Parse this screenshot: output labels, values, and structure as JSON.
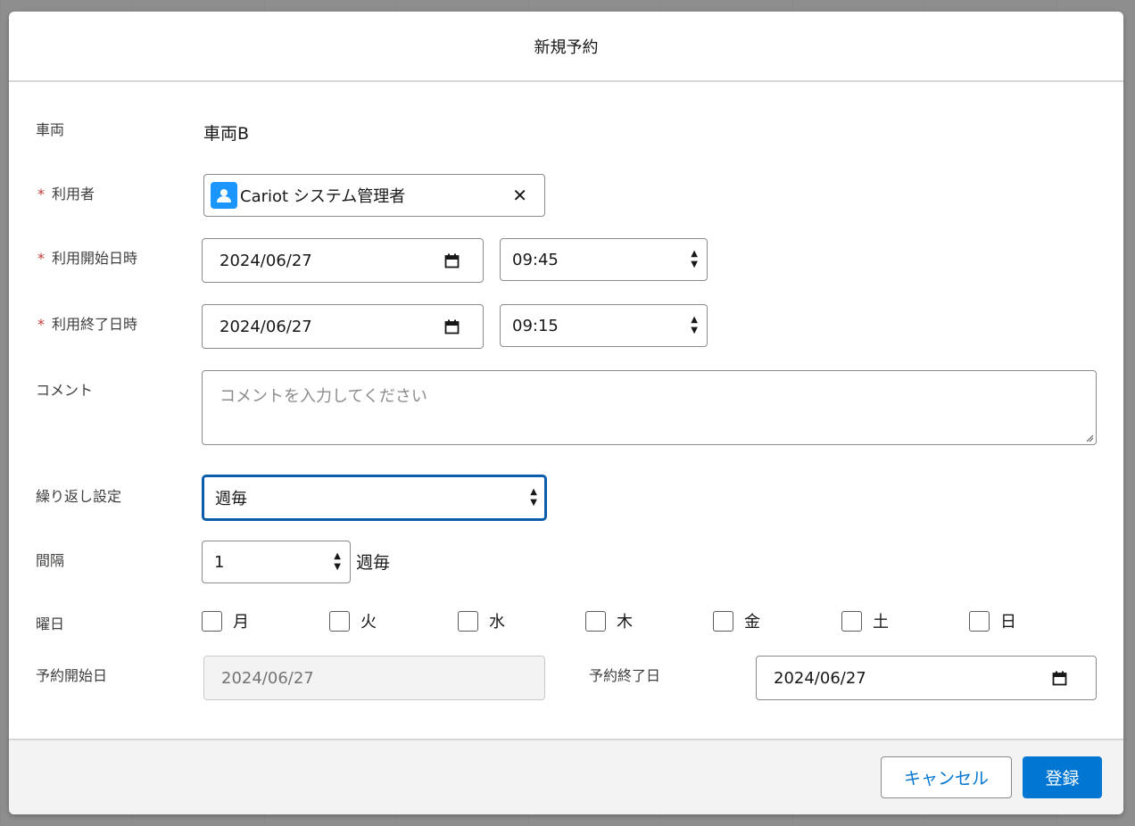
{
  "modal": {
    "title": "新規予約"
  },
  "vehicle": {
    "label": "車両",
    "value": "車両B"
  },
  "user": {
    "required_mark": "*",
    "label": "利用者",
    "value": "Cariot システム管理者",
    "clear_symbol": "✕",
    "icon": "user-icon"
  },
  "start": {
    "required_mark": "*",
    "label": "利用開始日時",
    "date": "2024/06/27",
    "time": "09:45"
  },
  "end": {
    "required_mark": "*",
    "label": "利用終了日時",
    "date": "2024/06/27",
    "time": "09:15"
  },
  "comment": {
    "label": "コメント",
    "placeholder": "コメントを入力してください",
    "value": ""
  },
  "repeat": {
    "label": "繰り返し設定",
    "selected": "週毎"
  },
  "interval": {
    "label": "間隔",
    "value": "1",
    "unit": "週毎"
  },
  "weekdays": {
    "label": "曜日",
    "days": [
      {
        "label": "月",
        "checked": false
      },
      {
        "label": "火",
        "checked": false
      },
      {
        "label": "水",
        "checked": false
      },
      {
        "label": "木",
        "checked": false
      },
      {
        "label": "金",
        "checked": false
      },
      {
        "label": "土",
        "checked": false
      },
      {
        "label": "日",
        "checked": false
      }
    ]
  },
  "booking_start": {
    "label": "予約開始日",
    "value": "2024/06/27"
  },
  "booking_end": {
    "label": "予約終了日",
    "value": "2024/06/27"
  },
  "footer": {
    "cancel_label": "キャンセル",
    "save_label": "登録"
  },
  "colors": {
    "brand": "#0176d3",
    "focus": "#0b5cab",
    "required": "#c23934",
    "user_icon_bg": "#1b96ff"
  }
}
